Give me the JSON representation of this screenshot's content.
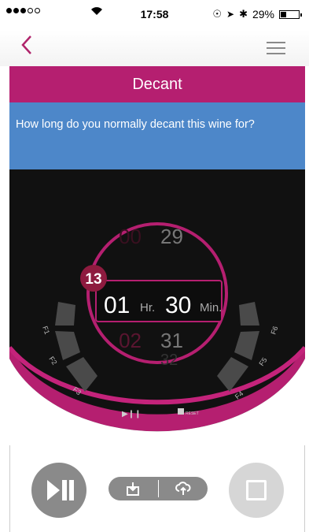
{
  "status_bar": {
    "time": "17:58",
    "battery": "29%",
    "battery_level": 0.29
  },
  "nav": {
    "back_icon": "chevron-left-icon",
    "menu_icon": "hamburger-menu-icon"
  },
  "header": {
    "title": "Decant"
  },
  "question": {
    "text": "How long do you normally decant this wine for?"
  },
  "picker": {
    "step_badge": "13",
    "hours_prev": "00",
    "hours_value": "01",
    "hours_next": "02",
    "hours_unit": "Hr.",
    "minutes_prev": "29",
    "minutes_value": "30",
    "minutes_next": "31",
    "minutes_next2": "32",
    "minutes_unit": "Min."
  },
  "dial": {
    "left_labels": [
      "F1",
      "F2",
      "F3"
    ],
    "right_labels": [
      "F4",
      "F5",
      "F6"
    ],
    "play_pause_label": "▶❙❙",
    "reset_label": "RESET"
  },
  "colors": {
    "brand": "#b51f70",
    "question_bg": "#4d87c9",
    "dial_bg": "#0d0d0d",
    "segment": "#4a4a4a"
  }
}
